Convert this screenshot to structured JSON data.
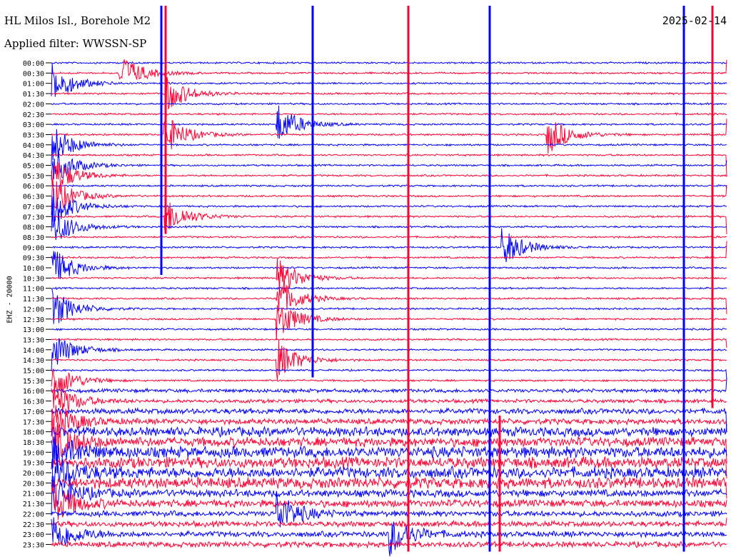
{
  "header": {
    "station": "HL Milos Isl., Borehole M2",
    "filter": "Applied filter: WWSSN-SP",
    "date": "2025-02-14",
    "channel": "EHZ - 20000"
  },
  "colors": {
    "trace_a": "#0000ff",
    "trace_b": "#ff0033"
  },
  "chart_data": {
    "type": "helicorder",
    "title": "HL Milos Isl., Borehole M2",
    "subtitle": "Applied filter: WWSSN-SP",
    "date": "2025-02-14",
    "ylabel": "EHZ - 20000",
    "line_duration_minutes": 30,
    "row_labels": [
      "00:00",
      "00:30",
      "01:00",
      "01:30",
      "02:00",
      "02:30",
      "03:00",
      "03:30",
      "04:00",
      "04:30",
      "05:00",
      "05:30",
      "06:00",
      "06:30",
      "07:00",
      "07:30",
      "08:00",
      "08:30",
      "09:00",
      "09:30",
      "10:00",
      "10:30",
      "11:00",
      "11:30",
      "12:00",
      "12:30",
      "13:00",
      "13:30",
      "14:00",
      "14:30",
      "15:00",
      "15:30",
      "16:00",
      "16:30",
      "17:00",
      "17:30",
      "18:00",
      "18:30",
      "19:00",
      "19:30",
      "20:00",
      "20:30",
      "21:00",
      "21:30",
      "22:00",
      "22:30",
      "23:00",
      "23:30"
    ],
    "series_colors": [
      "#0000ff",
      "#ff0033"
    ],
    "noise_level_by_hour": [
      1,
      1,
      1,
      1,
      1,
      1,
      1,
      1,
      1,
      1,
      1,
      1,
      1,
      1,
      1,
      1,
      2,
      3,
      5,
      6,
      6,
      4,
      3,
      3
    ],
    "events_minutes": [
      33,
      60,
      95,
      190,
      215,
      232,
      240,
      300,
      330,
      390,
      420,
      455,
      480,
      560,
      600,
      640,
      700,
      720,
      760,
      840,
      880,
      930,
      990,
      1050,
      1110,
      1140,
      1200,
      1260,
      1290,
      1330,
      1380,
      1395
    ]
  }
}
